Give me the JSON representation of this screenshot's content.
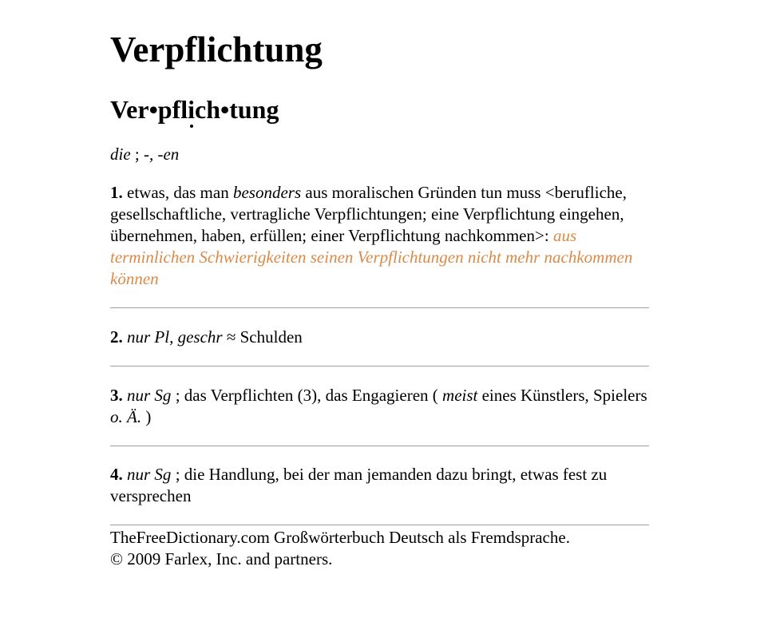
{
  "entry": {
    "headword": "Verpflichtung",
    "syllabified": {
      "part1": "Ver•pfl",
      "stressed": "i",
      "part2": "ch•tung"
    },
    "grammar": {
      "article": "die",
      "sep": " ; ",
      "inflection": "-, -en"
    }
  },
  "senses": [
    {
      "number": "1.",
      "text_a": " etwas, das man ",
      "text_italic": "besonders",
      "text_b": " aus moralischen Gründen tun muss <berufliche, gesellschaftliche, vertragliche Verpflichtungen; eine Verpflichtung eingehen, übernehmen, haben, erfüllen; einer Verpflichtung nachkommen>: ",
      "example": "aus terminlichen Schwierigkeiten seinen Verpflichtungen nicht mehr nachkommen können"
    },
    {
      "number": "2.",
      "label": " nur Pl, geschr",
      "text": " ≈ Schulden"
    },
    {
      "number": "3.",
      "label": " nur Sg",
      "text_a": " ; das Verpflichten (3), das Engagieren ( ",
      "text_italic": "meist",
      "text_b": " eines Künstlers, Spielers ",
      "abbr": "o. Ä.",
      "text_c": " )"
    },
    {
      "number": "4.",
      "label": " nur Sg",
      "text": " ; die Handlung, bei der man jemanden dazu bringt, etwas fest zu versprechen"
    }
  ],
  "footer": {
    "line1": "TheFreeDictionary.com Großwörterbuch Deutsch als Fremdsprache.",
    "line2": "© 2009 Farlex, Inc. and partners."
  },
  "colors": {
    "example": "#d98a47",
    "divider": "#9e9e9e",
    "text": "#000000"
  }
}
